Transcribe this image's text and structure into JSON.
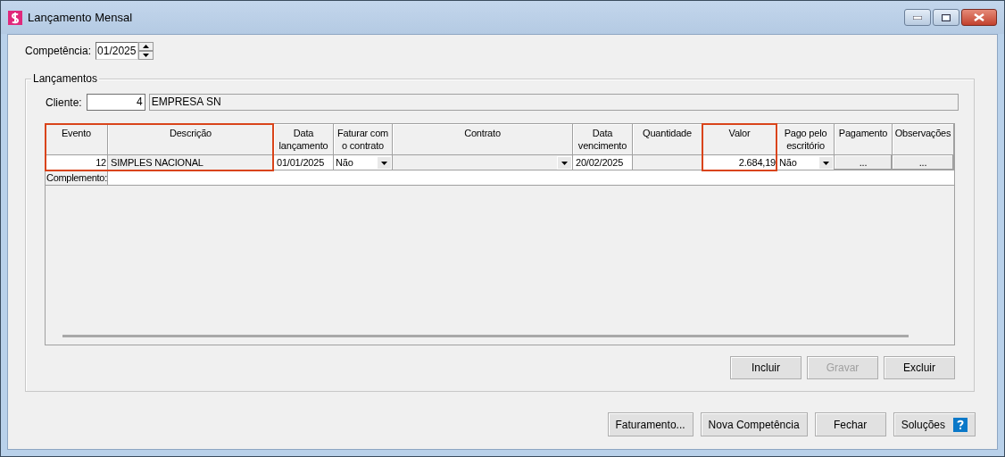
{
  "window": {
    "title": "Lançamento Mensal"
  },
  "competencia": {
    "label": "Competência:",
    "value": "01/2025"
  },
  "group": {
    "title": "Lançamentos"
  },
  "cliente": {
    "label": "Cliente:",
    "code": "4",
    "name": "EMPRESA SN"
  },
  "table": {
    "columns": [
      {
        "label": "Evento",
        "highlighted": true
      },
      {
        "label": "Descrição",
        "highlighted": true
      },
      {
        "label": "Data lançamento",
        "highlighted": false
      },
      {
        "label": "Faturar com o contrato",
        "highlighted": false
      },
      {
        "label": "Contrato",
        "highlighted": false
      },
      {
        "label": "Data vencimento",
        "highlighted": false
      },
      {
        "label": "Quantidade",
        "highlighted": false
      },
      {
        "label": "Valor",
        "highlighted": true
      },
      {
        "label": "Pago pelo escritório",
        "highlighted": false
      },
      {
        "label": "Pagamento",
        "highlighted": false
      },
      {
        "label": "Observações",
        "highlighted": false
      }
    ],
    "rows": [
      {
        "cells": [
          {
            "kind": "number",
            "value": "12",
            "readonly": false
          },
          {
            "kind": "text",
            "value": "SIMPLES NACIONAL",
            "readonly": true
          },
          {
            "kind": "text",
            "value": "01/01/2025",
            "readonly": false
          },
          {
            "kind": "combo",
            "value": "Não",
            "readonly": false
          },
          {
            "kind": "combo",
            "readonly": true
          },
          {
            "kind": "text",
            "value": "20/02/2025",
            "readonly": false
          },
          {
            "kind": "text",
            "readonly": true
          },
          {
            "kind": "number",
            "value": "2.684,19",
            "readonly": false
          },
          {
            "kind": "combo",
            "value": "Não",
            "readonly": false
          },
          {
            "kind": "button",
            "value": "..."
          },
          {
            "kind": "button",
            "value": "..."
          }
        ]
      }
    ],
    "complement_label": "Complemento:"
  },
  "group_buttons": [
    {
      "label": "Incluir",
      "disabled": false
    },
    {
      "label": "Gravar",
      "disabled": true
    },
    {
      "label": "Excluir",
      "disabled": false
    }
  ],
  "buttons": [
    {
      "label": "Faturamento...",
      "kind": "plain"
    },
    {
      "label": "Nova Competência",
      "kind": "plain"
    },
    {
      "label": "Fechar",
      "kind": "plain"
    },
    {
      "label": "Soluções",
      "kind": "help"
    }
  ]
}
